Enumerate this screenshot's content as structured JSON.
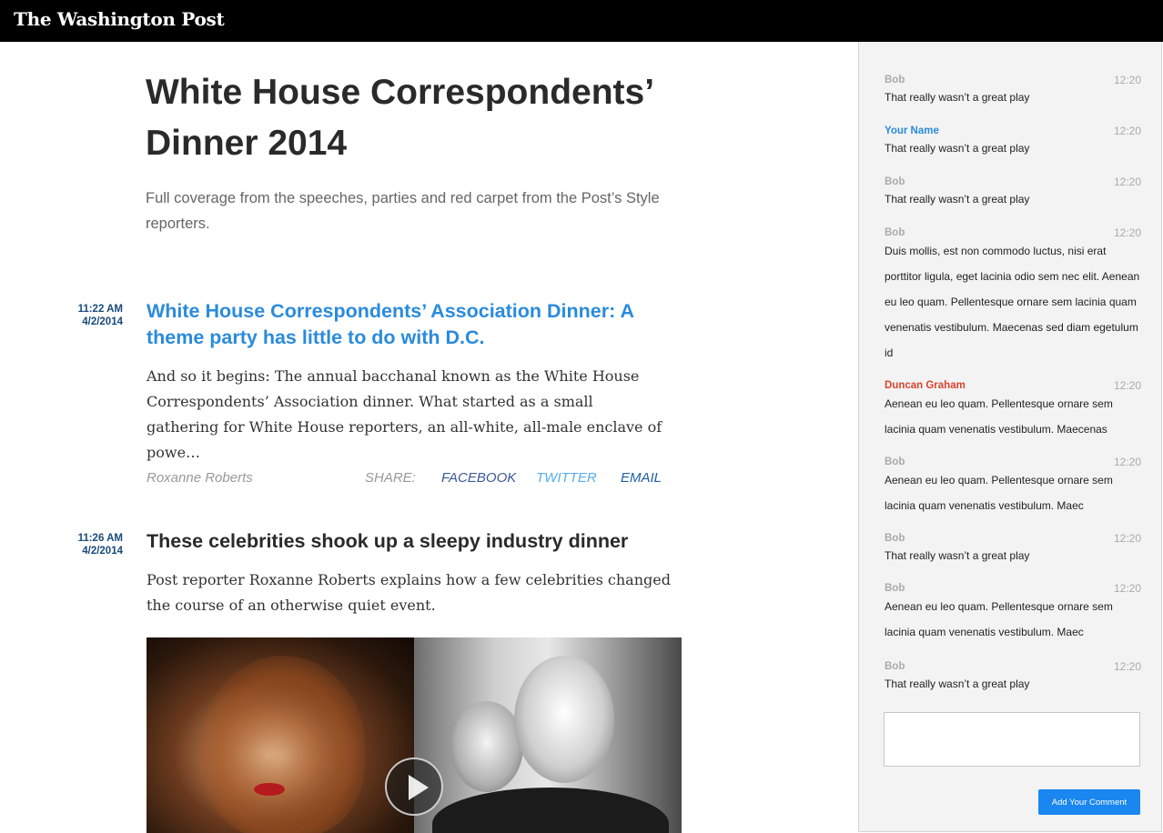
{
  "header": {
    "logo_text": "The Washington Post",
    "background": "#000000"
  },
  "page": {
    "title": "White House Correspondents’ Dinner 2014",
    "subtitle": "Full coverage from the speeches, parties and red carpet from the Post’s Style reporters."
  },
  "stories": [
    {
      "time": "11:22 AM",
      "date": "4/2/2014",
      "headline": "White House Correspondents’ Association Dinner: A theme party has little to do with D.C.",
      "body": "And so it begins: The annual bacchanal known as the White House Correspondents’ Association dinner. What started as a small gathering for White House reporters, an all-white, all-male enclave of powe…",
      "byline": "Roxanne Roberts",
      "share_label": "SHARE:",
      "share_links": {
        "facebook": "FACEBOOK",
        "twitter": "TWITTER",
        "email": "EMAIL"
      }
    },
    {
      "time": "11:26 AM",
      "date": "4/2/2014",
      "headline": "These celebrities shook up a sleepy industry dinner",
      "body": "Post reporter Roxanne Roberts explains how a few celebrities changed the course of an otherwise quiet event.",
      "media": {
        "type": "video",
        "icon": "play-icon"
      }
    }
  ],
  "comments": [
    {
      "author": "Bob",
      "time": "12:20",
      "text": "That really wasn’t a great play"
    },
    {
      "author": "Your Name",
      "time": "12:20",
      "text": "That really wasn’t a great play"
    },
    {
      "author": "Bob",
      "time": "12:20",
      "text": "That really wasn’t a great play"
    },
    {
      "author": "Bob",
      "time": "12:20",
      "text": "Duis mollis, est non commodo luctus, nisi erat porttitor ligula, eget lacinia odio sem nec elit. Aenean eu leo quam. Pellentesque ornare sem lacinia quam venenatis vestibulum. Maecenas sed diam egetulum id"
    },
    {
      "author": "Duncan Graham",
      "time": "12:20",
      "text": "Aenean eu leo quam. Pellentesque ornare sem lacinia quam venenatis vestibulum. Maecenas"
    },
    {
      "author": "Bob",
      "time": "12:20",
      "text": "Aenean eu leo quam. Pellentesque ornare sem lacinia quam venenatis vestibulum. Maec"
    },
    {
      "author": "Bob",
      "time": "12:20",
      "text": "That really wasn’t a great play"
    },
    {
      "author": "Bob",
      "time": "12:20",
      "text": "Aenean eu leo quam. Pellentesque ornare sem lacinia quam venenatis vestibulum. Maec"
    },
    {
      "author": "Bob",
      "time": "12:20",
      "text": "That really wasn’t a great play"
    }
  ],
  "comment_form": {
    "input_value": "",
    "submit_label": "Add Your Comment"
  },
  "colors": {
    "link_blue": "#2a8bdc",
    "timestamp_blue": "#1a4a7a",
    "highlight_red": "#d9442e",
    "facebook": "#3b5998",
    "twitter": "#55acee",
    "button_blue": "#1a86f0"
  }
}
